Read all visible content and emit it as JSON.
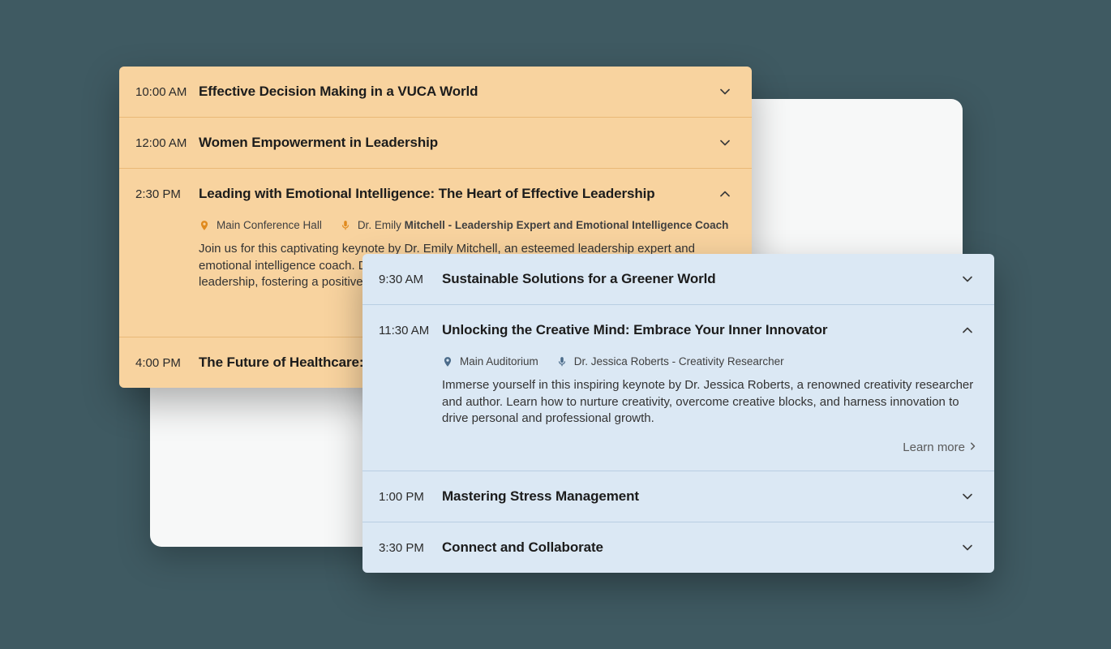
{
  "orange": {
    "items": [
      {
        "time": "10:00 AM",
        "title": "Effective Decision Making in a VUCA World",
        "expanded": false
      },
      {
        "time": "12:00 AM",
        "title": "Women Empowerment in Leadership",
        "expanded": false
      },
      {
        "time": "2:30 PM",
        "title": "Leading with Emotional Intelligence: The Heart of Effective Leadership",
        "expanded": true,
        "location": "Main Conference Hall",
        "speaker_prefix": "Dr. Emily ",
        "speaker_bold": "Mitchell - Leadership Expert and Emotional Intelligence Coach",
        "description": "Join us for this captivating keynote by Dr. Emily Mitchell, an esteemed leadership expert and emotional intelligence coach. Discover the transformative power of emotional intelligence in leadership, fostering a positive"
      },
      {
        "time": "4:00 PM",
        "title": "The Future of Healthcare:",
        "expanded": false
      }
    ]
  },
  "blue": {
    "items": [
      {
        "time": "9:30 AM",
        "title": "Sustainable Solutions for a Greener World",
        "expanded": false
      },
      {
        "time": "11:30 AM",
        "title": "Unlocking the Creative Mind: Embrace Your Inner Innovator",
        "expanded": true,
        "location": "Main Auditorium",
        "speaker": "Dr. Jessica Roberts - Creativity Researcher",
        "description": "Immerse yourself in this inspiring keynote by Dr. Jessica Roberts, a renowned creativity researcher and author. Learn how to nurture creativity, overcome creative blocks, and harness innovation to drive personal and professional growth.",
        "learn_more": "Learn more"
      },
      {
        "time": "1:00 PM",
        "title": "Mastering Stress Management",
        "expanded": false
      },
      {
        "time": "3:30 PM",
        "title": "Connect and Collaborate",
        "expanded": false
      }
    ]
  }
}
